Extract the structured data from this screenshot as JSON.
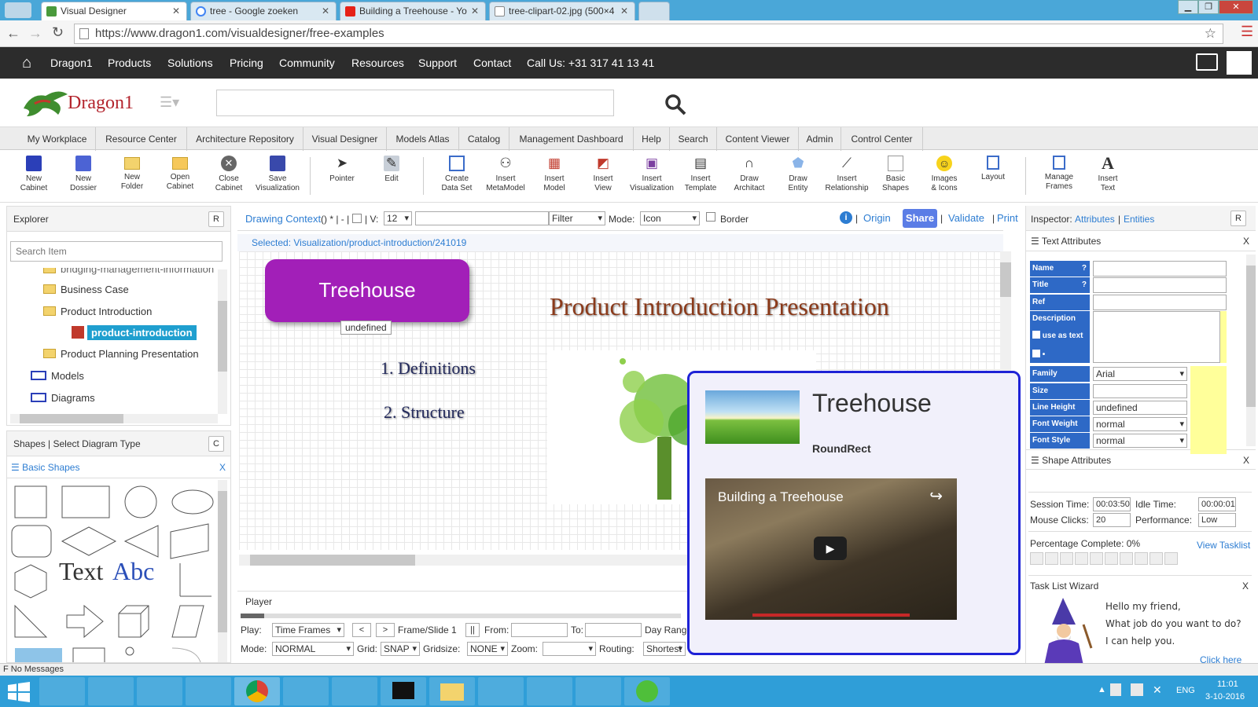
{
  "browser": {
    "tabs": [
      {
        "label": "Visual Designer",
        "active": true
      },
      {
        "label": "tree - Google zoeken"
      },
      {
        "label": "Building a Treehouse - Yo"
      },
      {
        "label": "tree-clipart-02.jpg (500×4"
      }
    ],
    "url": "https://www.dragon1.com/visualdesigner/free-examples"
  },
  "site_nav": {
    "items": [
      "Dragon1",
      "Products",
      "Solutions",
      "Pricing",
      "Community",
      "Resources",
      "Support",
      "Contact",
      "Call Us: +31 317 41 13 41"
    ]
  },
  "logo": {
    "text": "Dragon1"
  },
  "app_nav": {
    "items": [
      "My Workplace",
      "Resource Center",
      "Architecture Repository",
      "Visual Designer",
      "Models Atlas",
      "Catalog",
      "Management Dashboard",
      "Help",
      "Search",
      "Content Viewer",
      "Admin",
      "Control Center"
    ]
  },
  "toolbar": {
    "buttons": [
      {
        "line1": "New",
        "line2": "Cabinet"
      },
      {
        "line1": "New",
        "line2": "Dossier"
      },
      {
        "line1": "New",
        "line2": "Folder"
      },
      {
        "line1": "Open",
        "line2": "Cabinet"
      },
      {
        "line1": "Close",
        "line2": "Cabinet"
      },
      {
        "line1": "Save",
        "line2": "Visualization"
      },
      {
        "line1": "Pointer",
        "line2": ""
      },
      {
        "line1": "Edit",
        "line2": ""
      },
      {
        "line1": "Create",
        "line2": "Data Set"
      },
      {
        "line1": "Insert",
        "line2": "MetaModel"
      },
      {
        "line1": "Insert",
        "line2": "Model"
      },
      {
        "line1": "Insert",
        "line2": "View"
      },
      {
        "line1": "Insert",
        "line2": "Visualization"
      },
      {
        "line1": "Insert",
        "line2": "Template"
      },
      {
        "line1": "Draw",
        "line2": "Architact"
      },
      {
        "line1": "Draw",
        "line2": "Entity"
      },
      {
        "line1": "Insert",
        "line2": "Relationship"
      },
      {
        "line1": "Basic",
        "line2": "Shapes"
      },
      {
        "line1": "Images",
        "line2": "& Icons"
      },
      {
        "line1": "Layout",
        "line2": ""
      },
      {
        "line1": "Manage",
        "line2": "Frames"
      },
      {
        "line1": "Insert",
        "line2": "Text"
      }
    ]
  },
  "explorer": {
    "title": "Explorer",
    "reset": "R",
    "search_placeholder": "Search Item",
    "tree": [
      "bridging-management-information",
      "Business Case",
      "Product Introduction",
      "product-introduction",
      "Product Planning Presentation",
      "Models",
      "Diagrams"
    ]
  },
  "shapes": {
    "title": "Shapes | Select Diagram Type",
    "btn": "C",
    "section": "☰ Basic Shapes",
    "close": "X",
    "text_sample": "Text",
    "abc_sample": "Abc"
  },
  "context_bar": {
    "label": "Drawing Context",
    "suffix": "() * | - |",
    "v_label": "| V:",
    "v_value": "12",
    "filter": "Filter",
    "mode_label": "Mode:",
    "mode_value": "Icon",
    "border_label": "Border",
    "origin": "Origin",
    "share": "Share",
    "validate": "Validate",
    "print": "Print",
    "selected": "Selected: Visualization/product-introduction/241019"
  },
  "canvas": {
    "shape_label": "Treehouse",
    "shape_tag": "undefined",
    "title": "Product Introduction Presentation",
    "item1": "1. Definitions",
    "item2": "2. Structure"
  },
  "popup": {
    "title": "Treehouse",
    "subtitle": "RoundRect",
    "video_title": "Building a Treehouse"
  },
  "player": {
    "title": "Player",
    "play_label": "Play:",
    "play_value": "Time Frames",
    "prev": "<",
    "next": ">",
    "frame": "Frame/Slide 1",
    "pause": "||",
    "from": "From:",
    "to": "To:",
    "dayrange": "Day Range",
    "mode_label": "Mode:",
    "mode_value": "NORMAL",
    "grid_label": "Grid:",
    "grid_value": "SNAP",
    "gridsize_label": "Gridsize:",
    "gridsize_value": "NONE",
    "zoom_label": "Zoom:",
    "routing_label": "Routing:",
    "routing_value": "Shortest Path"
  },
  "inspector": {
    "title": "Inspector:",
    "link1": "Attributes",
    "sep": "|",
    "link2": "Entities",
    "btn": "R",
    "text_attrs": "☰ Text Attributes",
    "shape_attrs": "☰ Shape Attributes",
    "close": "X",
    "rows": [
      {
        "label": "Name",
        "help": "?",
        "value": ""
      },
      {
        "label": "Title",
        "help": "?",
        "value": ""
      },
      {
        "label": "Ref",
        "help": "",
        "value": ""
      }
    ],
    "description": "Description",
    "use_as_text": "use as text",
    "family": {
      "label": "Family",
      "value": "Arial"
    },
    "size": {
      "label": "Size",
      "value": ""
    },
    "line_height": {
      "label": "Line Height",
      "value": "undefined"
    },
    "font_weight": {
      "label": "Font Weight",
      "value": "normal"
    },
    "font_style": {
      "label": "Font Style",
      "value": "normal"
    }
  },
  "stats": {
    "session_label": "Session Time:",
    "session_value": "00:03:50",
    "idle_label": "Idle Time:",
    "idle_value": "00:00:01",
    "clicks_label": "Mouse Clicks:",
    "clicks_value": "20",
    "perf_label": "Performance:",
    "perf_value": "Low",
    "pct_label": "Percentage Complete: 0%",
    "pct_value": 0,
    "view_tasklist": "View Tasklist"
  },
  "wizard": {
    "title": "Task List Wizard",
    "close": "X",
    "line1": "Hello my friend,",
    "line2": "What job do you want to do?",
    "line3": "I can help you.",
    "more": "Click here"
  },
  "status": {
    "text": "F No Messages"
  },
  "taskbar": {
    "lang": "ENG",
    "time": "11:01",
    "date": "3-10-2016"
  },
  "colors": {
    "accent": "#2e69c6",
    "shape": "#a21fb8",
    "share": "#5b7de6",
    "titlebar": "#4aa7d8"
  }
}
